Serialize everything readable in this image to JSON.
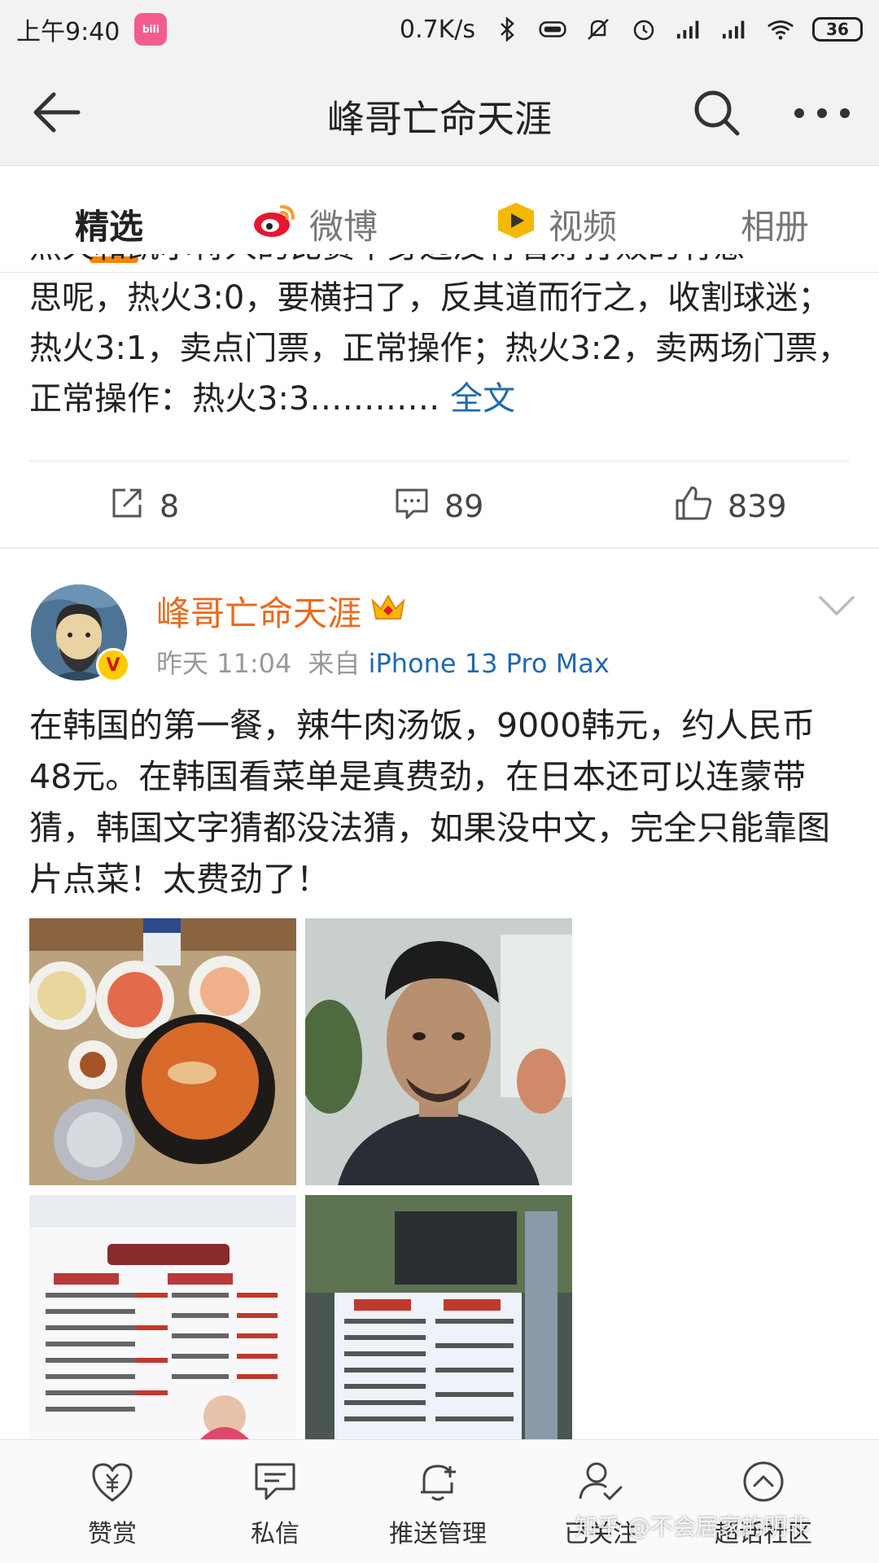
{
  "status_bar": {
    "time": "上午9:40",
    "app_icon": "bilibili",
    "net_speed": "0.7K/s",
    "battery": "36"
  },
  "nav": {
    "title": "峰哥亡命天涯"
  },
  "tabs": [
    {
      "label": "精选",
      "active": true
    },
    {
      "label": "微博",
      "icon": "weibo-icon"
    },
    {
      "label": "视频",
      "icon": "video-icon"
    },
    {
      "label": "相册"
    }
  ],
  "post1": {
    "clipped_line": "热火和凯尔特人的比赛中身边没有看好打败的有意",
    "text": "思呢，热火3:0，要横扫了，反其道而行之，收割球迷；热火3:1，卖点门票，正常操作；热火3:2，卖两场门票，正常操作：热火3:3…………",
    "more_link": "全文",
    "reposts": "8",
    "comments": "89",
    "likes": "839"
  },
  "post2": {
    "author": "峰哥亡命天涯",
    "time": "昨天 11:04",
    "source_prefix": "来自",
    "device": "iPhone 13 Pro Max",
    "text": "在韩国的第一餐，辣牛肉汤饭，9000韩元，约人民币48元。在韩国看菜单是真费劲，在日本还可以连蒙带猜，韩国文字猜都没法猜，如果没中文，完全只能靠图片点菜！太费劲了！",
    "photos": [
      {
        "name": "food-photo"
      },
      {
        "name": "selfie-photo"
      },
      {
        "name": "menu-board-photo"
      },
      {
        "name": "menu-sign-photo"
      }
    ]
  },
  "bottom_bar": [
    {
      "label": "赞赏",
      "icon": "reward-icon"
    },
    {
      "label": "私信",
      "icon": "message-icon"
    },
    {
      "label": "推送管理",
      "icon": "bell-plus-icon"
    },
    {
      "label": "已关注",
      "icon": "user-check-icon"
    },
    {
      "label": "超话社区",
      "icon": "topic-icon"
    }
  ],
  "watermark": "知乎 @不会居家的明非"
}
